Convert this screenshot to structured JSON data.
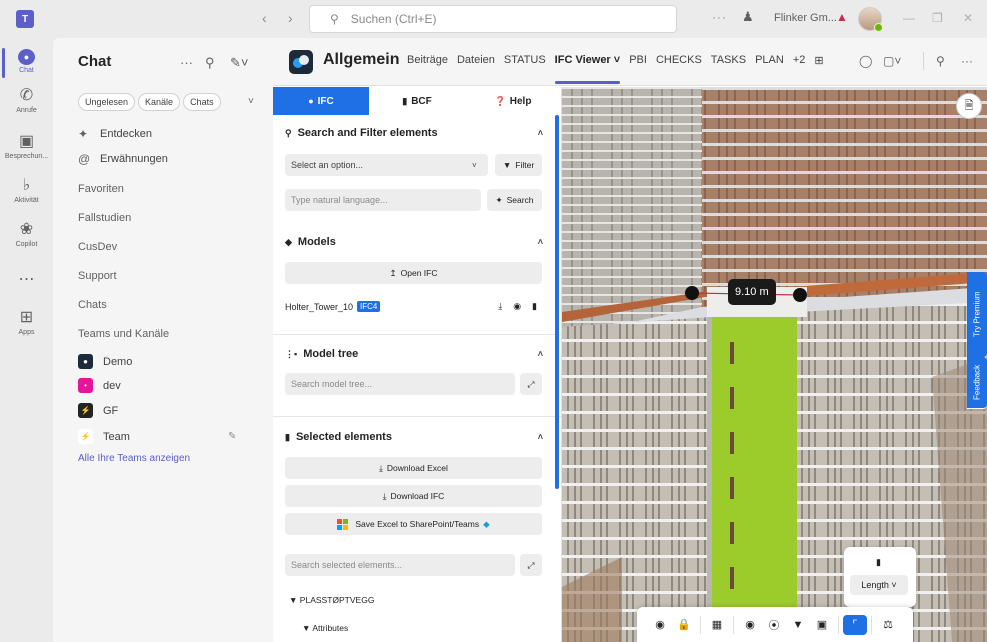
{
  "titlebar": {
    "logo": "T",
    "search_placeholder": "Suchen (Ctrl+E)",
    "more": "···",
    "org_name": "Flinker Gm..."
  },
  "rail": [
    {
      "label": "Chat",
      "icon": "chat-icon"
    },
    {
      "label": "Anrufe",
      "icon": "phone-icon"
    },
    {
      "label": "Besprechun...",
      "icon": "meeting-icon"
    },
    {
      "label": "Aktivität",
      "icon": "bell-icon"
    },
    {
      "label": "Copilot",
      "icon": "copilot-icon"
    },
    {
      "label": "",
      "icon": "more-icon"
    },
    {
      "label": "Apps",
      "icon": "apps-icon"
    }
  ],
  "chatpanel": {
    "title": "Chat",
    "filters": [
      "Ungelesen",
      "Kanäle",
      "Chats"
    ],
    "quick": [
      {
        "label": "Entdecken",
        "icon": "discover-icon"
      },
      {
        "label": "Erwähnungen",
        "icon": "mention-icon"
      }
    ],
    "sections": [
      "Favoriten",
      "Fallstudien",
      "CusDev",
      "Support",
      "Chats",
      "Teams und Kanäle"
    ],
    "teams": [
      {
        "name": "Demo",
        "color": "#1c2a3a"
      },
      {
        "name": "dev",
        "color": "#e5149b"
      },
      {
        "name": "GF",
        "color": "#242424"
      },
      {
        "name": "Team",
        "color": "#ffffff"
      }
    ],
    "all_teams_link": "Alle Ihre Teams anzeigen"
  },
  "channel": {
    "name": "Allgemein",
    "tabs": [
      "Beiträge",
      "Dateien",
      "STATUS",
      "IFC Viewer",
      "PBI",
      "CHECKS",
      "TASKS",
      "PLAN"
    ],
    "active_tab": "IFC Viewer",
    "more_tabs": "+2"
  },
  "ifc": {
    "panel_tabs": [
      {
        "label": "IFC",
        "icon": "ifc-icon"
      },
      {
        "label": "BCF",
        "icon": "bcf-icon"
      },
      {
        "label": "Help",
        "icon": "help-icon"
      }
    ],
    "search_section": {
      "title": "Search and Filter elements",
      "select_value": "Select an option...",
      "filter_label": "Filter",
      "nl_placeholder": "Type natural language...",
      "search_label": "Search"
    },
    "models_section": {
      "title": "Models",
      "open_label": "Open IFC",
      "model_name": "Holter_Tower_10",
      "model_badge": "IFC4"
    },
    "tree_section": {
      "title": "Model tree",
      "search_placeholder": "Search model tree..."
    },
    "selected_section": {
      "title": "Selected elements",
      "download_excel": "Download Excel",
      "download_ifc": "Download IFC",
      "save_sharepoint": "Save Excel to SharePoint/Teams",
      "search_placeholder": "Search selected elements...",
      "tree_root": "PLASSTØPTVEGG",
      "tree_child": "Attributes"
    }
  },
  "viewer": {
    "measure_value": "9.10 m",
    "premium_label": "Try Premium",
    "feedback_label": "Feedback",
    "measure_mode": "Length",
    "accent_color": "#1f6fe5",
    "highlight_color": "#9ccc2c"
  }
}
